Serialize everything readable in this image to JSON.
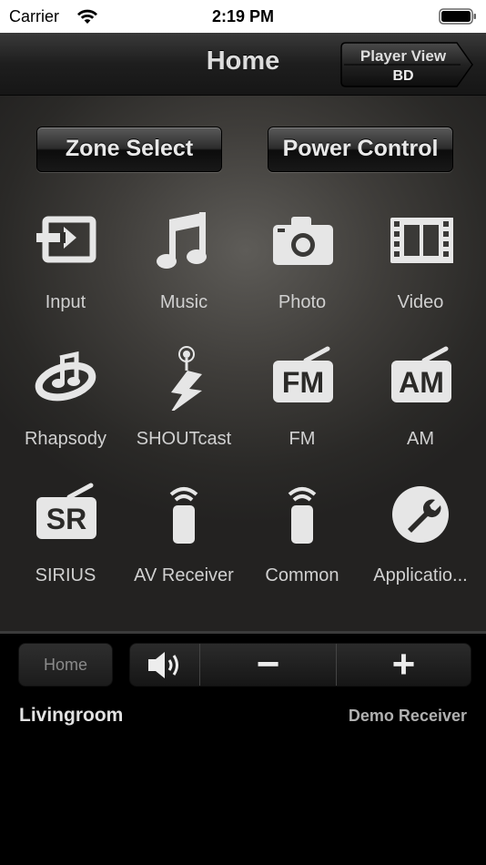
{
  "status_bar": {
    "carrier": "Carrier",
    "time": "2:19 PM"
  },
  "nav": {
    "title": "Home",
    "player_view": {
      "line1": "Player View",
      "line2": "BD"
    }
  },
  "main": {
    "zone_select": "Zone Select",
    "power_control": "Power Control",
    "tiles": [
      {
        "label": "Input",
        "icon": "input-icon"
      },
      {
        "label": "Music",
        "icon": "music-note-icon"
      },
      {
        "label": "Photo",
        "icon": "camera-icon"
      },
      {
        "label": "Video",
        "icon": "film-strip-icon"
      },
      {
        "label": "Rhapsody",
        "icon": "rhapsody-icon"
      },
      {
        "label": "SHOUTcast",
        "icon": "shoutcast-icon"
      },
      {
        "label": "FM",
        "icon": "fm-radio-icon"
      },
      {
        "label": "AM",
        "icon": "am-radio-icon"
      },
      {
        "label": "SIRIUS",
        "icon": "sirius-radio-icon"
      },
      {
        "label": "AV Receiver",
        "icon": "remote-icon"
      },
      {
        "label": "Common",
        "icon": "remote-icon"
      },
      {
        "label": "Applicatio...",
        "icon": "wrench-icon"
      }
    ]
  },
  "bottom": {
    "home": "Home",
    "volume": {
      "minus": "−",
      "plus": "+"
    },
    "zone_name": "Livingroom",
    "receiver_name": "Demo Receiver"
  },
  "colors": {
    "background": "#000000",
    "panel": "#3f3d3a",
    "icon": "#e6e6e6"
  }
}
